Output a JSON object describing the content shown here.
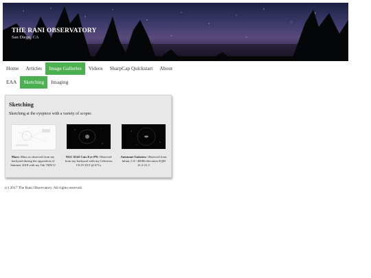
{
  "header": {
    "title": "THE RANI OBSERVATORY",
    "subtitle": "San Diego, CA"
  },
  "nav": {
    "items": [
      {
        "label": "Home",
        "active": false
      },
      {
        "label": "Articles",
        "active": false
      },
      {
        "label": "Image Galleries",
        "active": true
      },
      {
        "label": "Videos",
        "active": false
      },
      {
        "label": "SharpCap Quickstart",
        "active": false
      },
      {
        "label": "About",
        "active": false
      }
    ]
  },
  "subnav": {
    "items": [
      {
        "label": "EAA",
        "active": false
      },
      {
        "label": "Sketching",
        "active": true
      },
      {
        "label": "Imaging",
        "active": false
      }
    ]
  },
  "gallery": {
    "title": "Sketching",
    "description": "Sketching at the eyepiece with a variety of scopes",
    "items": [
      {
        "caption_title": "Mars:",
        "caption_text": "Mars as observed from my backyard during the opposition of Summer 2018 with my Tak 76DCU"
      },
      {
        "caption_title": "NGC 6543 Cats Eye PN:",
        "caption_text": "Observed from my backyard with my Celestron C9.25 XLT @ 671x"
      },
      {
        "caption_title": "Antennae Galaxies:",
        "caption_text": "Observed from Julian, CA--4000ft elevation SQM 21.2-21.3"
      }
    ]
  },
  "footer": {
    "text": "(c) 2017 The Rani Observatory. All rights reserved."
  },
  "colors": {
    "accent": "#4caf50",
    "card_background": "#e8e8e8"
  }
}
